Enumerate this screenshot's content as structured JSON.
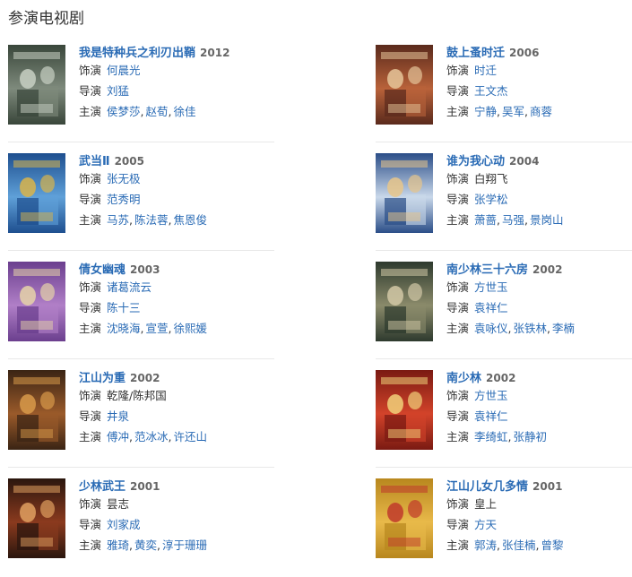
{
  "section_title": "参演电视剧",
  "labels": {
    "role": "饰演",
    "director": "导演",
    "stars": "主演"
  },
  "items": [
    {
      "title": "我是特种兵之利刃出鞘",
      "year": "2012",
      "role": "何晨光",
      "role_linked": true,
      "director": "刘猛",
      "stars": [
        "侯梦莎",
        "赵荀",
        "徐佳"
      ],
      "poster_colors": [
        "#39463a",
        "#7e8a7c",
        "#c8d0c3"
      ]
    },
    {
      "title": "鼓上蚤时迁",
      "year": "2006",
      "role": "时迁",
      "role_linked": true,
      "director": "王文杰",
      "stars": [
        "宁静",
        "吴军",
        "商蓉"
      ],
      "poster_colors": [
        "#5a2a1c",
        "#b9623a",
        "#e6c59a"
      ]
    },
    {
      "title": "武当Ⅱ",
      "year": "2005",
      "role": "张无极",
      "role_linked": true,
      "director": "范秀明",
      "stars": [
        "马苏",
        "陈法蓉",
        "焦恩俊"
      ],
      "poster_colors": [
        "#1e4f8f",
        "#5fa0d8",
        "#d9b44a"
      ]
    },
    {
      "title": "谁为我心动",
      "year": "2004",
      "role": "白翔飞",
      "role_linked": false,
      "director": "张学松",
      "stars": [
        "萧蔷",
        "马强",
        "景岗山"
      ],
      "poster_colors": [
        "#2b4e88",
        "#c9d8ea",
        "#e7c58a"
      ]
    },
    {
      "title": "倩女幽魂",
      "year": "2003",
      "role": "诸葛流云",
      "role_linked": true,
      "director": "陈十三",
      "stars": [
        "沈晓海",
        "宣萱",
        "徐熙媛"
      ],
      "poster_colors": [
        "#6b3f8e",
        "#b07fc7",
        "#e6d3a8"
      ]
    },
    {
      "title": "南少林三十六房",
      "year": "2002",
      "role": "方世玉",
      "role_linked": true,
      "director": "袁祥仁",
      "stars": [
        "袁咏仪",
        "张铁林",
        "李楠"
      ],
      "poster_colors": [
        "#2e3a2e",
        "#8a8a6a",
        "#d2c8a6"
      ]
    },
    {
      "title": "江山为重",
      "year": "2002",
      "role": "乾隆/陈邦国",
      "role_linked": false,
      "director": "井泉",
      "stars": [
        "傅冲",
        "范冰冰",
        "许还山"
      ],
      "poster_colors": [
        "#3a2414",
        "#9a5a2a",
        "#d89a4a"
      ]
    },
    {
      "title": "南少林",
      "year": "2002",
      "role": "方世玉",
      "role_linked": true,
      "director": "袁祥仁",
      "stars": [
        "李绮虹",
        "张静初"
      ],
      "poster_colors": [
        "#7a1a12",
        "#d2432a",
        "#f1d17a"
      ]
    },
    {
      "title": "少林武王",
      "year": "2001",
      "role": "昙志",
      "role_linked": false,
      "director": "刘家成",
      "stars": [
        "雅琦",
        "黄奕",
        "淳于珊珊"
      ],
      "poster_colors": [
        "#2a160e",
        "#8a3a1e",
        "#e0a060"
      ]
    },
    {
      "title": "江山儿女几多情",
      "year": "2001",
      "role": "皇上",
      "role_linked": false,
      "director": "方天",
      "stars": [
        "郭涛",
        "张佳楠",
        "曾黎"
      ],
      "poster_colors": [
        "#b8871e",
        "#e8b94a",
        "#c0392b"
      ]
    }
  ]
}
